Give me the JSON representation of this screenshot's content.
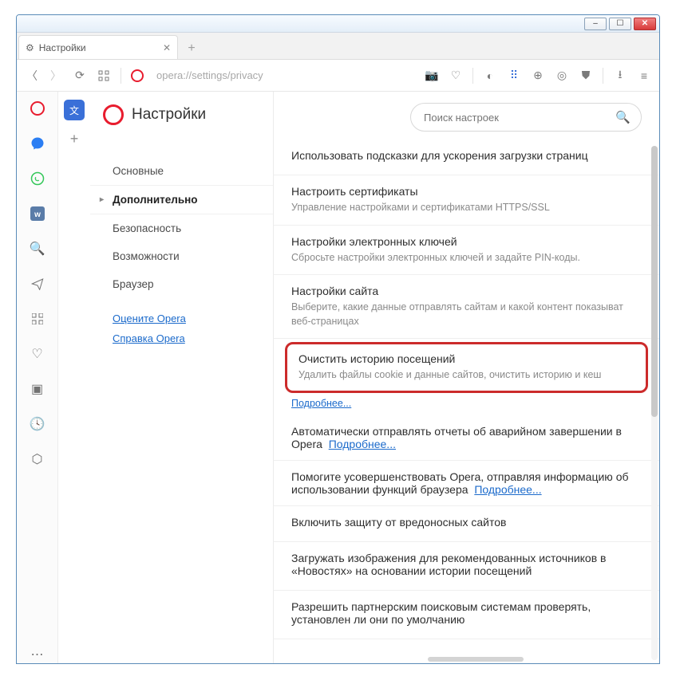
{
  "window_controls": {
    "min": "–",
    "max": "☐",
    "close": "✕"
  },
  "tab": {
    "title": "Настройки"
  },
  "toolbar": {
    "url": "opera://settings/privacy"
  },
  "search": {
    "placeholder": "Поиск настроек"
  },
  "sidebar": {
    "title": "Настройки",
    "nav": [
      {
        "label": "Основные"
      },
      {
        "label": "Дополнительно"
      },
      {
        "label": "Безопасность"
      },
      {
        "label": "Возможности"
      },
      {
        "label": "Браузер"
      }
    ],
    "links": [
      {
        "label": "Оцените Opera"
      },
      {
        "label": "Справка Opera"
      }
    ]
  },
  "sections": {
    "s0": {
      "title": "Использовать подсказки для ускорения загрузки страниц"
    },
    "s1": {
      "title": "Настроить сертификаты",
      "desc": "Управление настройками и сертификатами HTTPS/SSL"
    },
    "s2": {
      "title": "Настройки электронных ключей",
      "desc": "Сбросьте настройки электронных ключей и задайте PIN-коды."
    },
    "s3": {
      "title": "Настройки сайта",
      "desc": "Выберите, какие данные отправлять сайтам и какой контент показыват веб-страницах"
    },
    "s4": {
      "title": "Очистить историю посещений",
      "desc": "Удалить файлы cookie и данные сайтов, очистить историю и кеш"
    },
    "more4": "Подробнее...",
    "s5": {
      "title": "Автоматически отправлять отчеты об аварийном завершении в Opera",
      "more": "Подробнее..."
    },
    "s6": {
      "title": "Помогите усовершенствовать Opera, отправляя информацию об использовании функций браузера",
      "more": "Подробнее..."
    },
    "s7": {
      "title": "Включить защиту от вредоносных сайтов"
    },
    "s8": {
      "title": "Загружать изображения для рекомендованных источников в «Новостях» на основании истории посещений"
    },
    "s9": {
      "title": "Разрешить партнерским поисковым системам проверять, установлен ли они по умолчанию"
    }
  }
}
